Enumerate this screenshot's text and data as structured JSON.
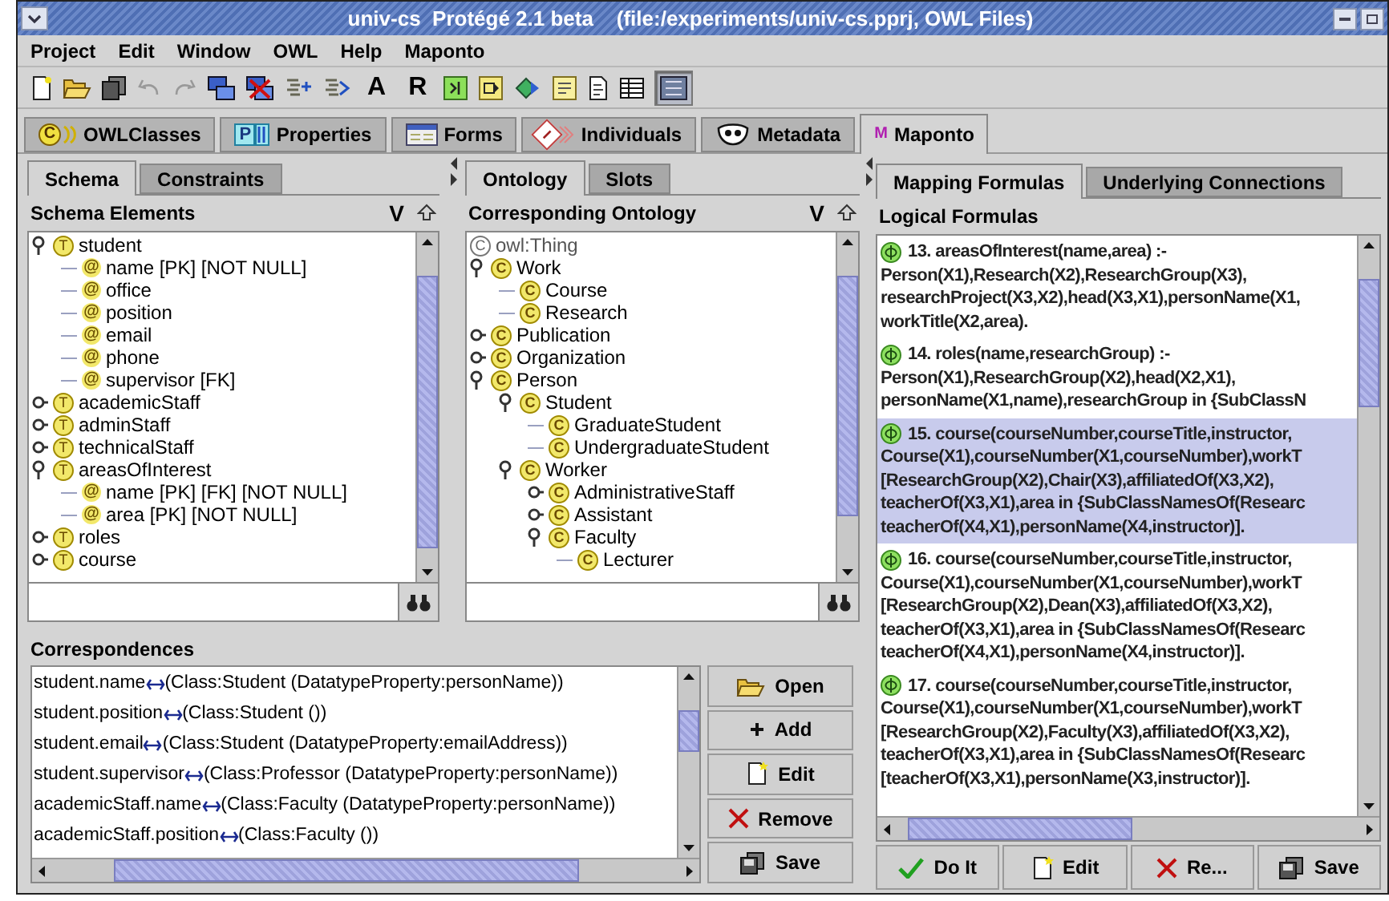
{
  "window": {
    "title": "univ-cs  Protégé 2.1 beta    (file:/experiments/univ-cs.pprj, OWL Files)"
  },
  "menu": [
    "Project",
    "Edit",
    "Window",
    "OWL",
    "Help",
    "Maponto"
  ],
  "toolbar": {
    "text_buttons": [
      "A",
      "R"
    ],
    "last_pressed": true
  },
  "tabs": [
    {
      "label": "OWLClasses",
      "badge": "C",
      "kind": "classes",
      "selected": false
    },
    {
      "label": "Properties",
      "badge": "P",
      "kind": "properties",
      "selected": false
    },
    {
      "label": "Forms",
      "kind": "forms",
      "selected": false
    },
    {
      "label": "Individuals",
      "badge": "I",
      "kind": "individuals",
      "selected": false
    },
    {
      "label": "Metadata",
      "kind": "metadata",
      "selected": false
    },
    {
      "label": "Maponto",
      "badge": "M",
      "kind": "maponto",
      "selected": true
    }
  ],
  "schema_panel": {
    "tabs": [
      {
        "label": "Schema",
        "selected": true
      },
      {
        "label": "Constraints",
        "selected": false
      }
    ],
    "title": "Schema Elements",
    "view_label": "V",
    "tree": [
      {
        "label": "student",
        "badge": "T",
        "kind": "table",
        "expanded": true,
        "children": [
          {
            "label": "name [PK] [NOT NULL]",
            "badge": "@",
            "kind": "attribute"
          },
          {
            "label": "office",
            "badge": "@",
            "kind": "attribute"
          },
          {
            "label": "position",
            "badge": "@",
            "kind": "attribute"
          },
          {
            "label": "email",
            "badge": "@",
            "kind": "attribute"
          },
          {
            "label": "phone",
            "badge": "@",
            "kind": "attribute"
          },
          {
            "label": "supervisor [FK]",
            "badge": "@",
            "kind": "attribute"
          }
        ]
      },
      {
        "label": "academicStaff",
        "badge": "T",
        "kind": "table",
        "expanded": false
      },
      {
        "label": "adminStaff",
        "badge": "T",
        "kind": "table",
        "expanded": false
      },
      {
        "label": "technicalStaff",
        "badge": "T",
        "kind": "table",
        "expanded": false
      },
      {
        "label": "areasOfInterest",
        "badge": "T",
        "kind": "table",
        "expanded": true,
        "children": [
          {
            "label": "name [PK] [FK] [NOT NULL]",
            "badge": "@",
            "kind": "attribute"
          },
          {
            "label": "area [PK] [NOT NULL]",
            "badge": "@",
            "kind": "attribute"
          }
        ]
      },
      {
        "label": "roles",
        "badge": "T",
        "kind": "table",
        "expanded": false
      },
      {
        "label": "course",
        "badge": "T",
        "kind": "table",
        "expanded": false
      }
    ]
  },
  "ontology_panel": {
    "tabs": [
      {
        "label": "Ontology",
        "selected": true
      },
      {
        "label": "Slots",
        "selected": false
      }
    ],
    "title": "Corresponding Ontology",
    "view_label": "V",
    "tree": [
      {
        "label": "owl:Thing",
        "badge": "C",
        "kind": "root"
      },
      {
        "label": "Work",
        "badge": "C",
        "kind": "class",
        "expanded": true,
        "children": [
          {
            "label": "Course",
            "badge": "C",
            "kind": "class"
          },
          {
            "label": "Research",
            "badge": "C",
            "kind": "class"
          }
        ]
      },
      {
        "label": "Publication",
        "badge": "C",
        "kind": "class",
        "expanded": false
      },
      {
        "label": "Organization",
        "badge": "C",
        "kind": "class",
        "expanded": false
      },
      {
        "label": "Person",
        "badge": "C",
        "kind": "class",
        "expanded": true,
        "children": [
          {
            "label": "Student",
            "badge": "C",
            "kind": "class",
            "expanded": true,
            "children": [
              {
                "label": "GraduateStudent",
                "badge": "C",
                "kind": "class"
              },
              {
                "label": "UndergraduateStudent",
                "badge": "C",
                "kind": "class"
              }
            ]
          },
          {
            "label": "Worker",
            "badge": "C",
            "kind": "class",
            "expanded": true,
            "children": [
              {
                "label": "AdministrativeStaff",
                "badge": "C",
                "kind": "class",
                "expanded": false
              },
              {
                "label": "Assistant",
                "badge": "C",
                "kind": "class",
                "expanded": false
              },
              {
                "label": "Faculty",
                "badge": "C",
                "kind": "class",
                "expanded": true,
                "children": [
                  {
                    "label": "Lecturer",
                    "badge": "C",
                    "kind": "class"
                  }
                ]
              }
            ]
          }
        ]
      }
    ]
  },
  "correspondences": {
    "title": "Correspondences",
    "rows": [
      {
        "left": "student.name",
        "right": "(Class:Student (DatatypeProperty:personName))"
      },
      {
        "left": "student.position",
        "right": "(Class:Student ())"
      },
      {
        "left": "student.email",
        "right": "(Class:Student (DatatypeProperty:emailAddress))"
      },
      {
        "left": "student.supervisor",
        "right": "(Class:Professor (DatatypeProperty:personName))"
      },
      {
        "left": "academicStaff.name",
        "right": "(Class:Faculty (DatatypeProperty:personName))"
      },
      {
        "left": "academicStaff.position",
        "right": "(Class:Faculty ())"
      }
    ],
    "buttons": [
      {
        "label": "Open",
        "kind": "open"
      },
      {
        "label": "Add",
        "kind": "add"
      },
      {
        "label": "Edit",
        "kind": "edit"
      },
      {
        "label": "Remove",
        "kind": "remove"
      },
      {
        "label": "Save",
        "kind": "save"
      }
    ]
  },
  "mapping_panel": {
    "tabs": [
      {
        "label": "Mapping Formulas",
        "selected": true
      },
      {
        "label": "Underlying Connections",
        "selected": false
      }
    ],
    "title": "Logical Formulas",
    "formulas": [
      {
        "selected": false,
        "lines": [
          "13. areasOfInterest(name,area) :-",
          "Person(X1),Research(X2),ResearchGroup(X3),",
          "researchProject(X3,X2),head(X3,X1),personName(X1,",
          "workTitle(X2,area)."
        ]
      },
      {
        "selected": false,
        "lines": [
          "14. roles(name,researchGroup) :-",
          "Person(X1),ResearchGroup(X2),head(X2,X1),",
          "personName(X1,name),researchGroup in {SubClassN"
        ]
      },
      {
        "selected": true,
        "lines": [
          "15. course(courseNumber,courseTitle,instructor,",
          "Course(X1),courseNumber(X1,courseNumber),workT",
          "[ResearchGroup(X2),Chair(X3),affiliatedOf(X3,X2),",
          "teacherOf(X3,X1),area in {SubClassNamesOf(Researc",
          "teacherOf(X4,X1),personName(X4,instructor)]."
        ]
      },
      {
        "selected": false,
        "lines": [
          "16. course(courseNumber,courseTitle,instructor,",
          "Course(X1),courseNumber(X1,courseNumber),workT",
          "[ResearchGroup(X2),Dean(X3),affiliatedOf(X3,X2),",
          "teacherOf(X3,X1),area in {SubClassNamesOf(Researc",
          "teacherOf(X4,X1),personName(X4,instructor)]."
        ]
      },
      {
        "selected": false,
        "lines": [
          "17. course(courseNumber,courseTitle,instructor,",
          "Course(X1),courseNumber(X1,courseNumber),workT",
          "[ResearchGroup(X2),Faculty(X3),affiliatedOf(X3,X2),",
          "teacherOf(X3,X1),area in {SubClassNamesOf(Researc",
          "[teacherOf(X3,X1),personName(X3,instructor)]."
        ]
      }
    ],
    "buttons": [
      {
        "label": "Do It",
        "kind": "do"
      },
      {
        "label": "Edit",
        "kind": "edit"
      },
      {
        "label": "Re...",
        "kind": "remove"
      },
      {
        "label": "Save",
        "kind": "save"
      }
    ]
  }
}
